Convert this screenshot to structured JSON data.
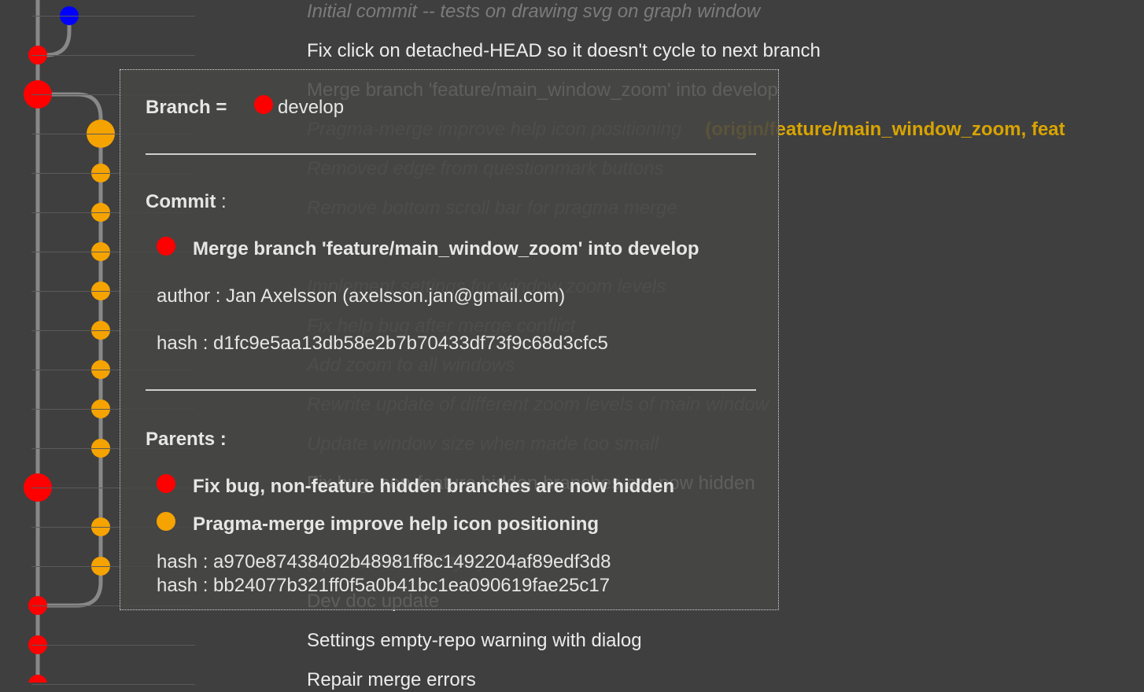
{
  "colors": {
    "background": "#3f3f3f",
    "branch_develop": "#ff0000",
    "branch_feature": "#f5a300",
    "branch_hidden": "#0000ff",
    "edge": "#888888",
    "hidden_text": "#7b7b7b",
    "refs_text": "#d9a400"
  },
  "commits": [
    {
      "message": "Initial commit -- tests on drawing svg on graph window",
      "style": "hidden",
      "node": "branch_hidden",
      "size": "small"
    },
    {
      "message": "Fix click on detached-HEAD so it doesn't cycle to next branch",
      "style": "normal",
      "node": "branch_develop",
      "size": "small"
    },
    {
      "message": "Merge branch 'feature/main_window_zoom' into develop",
      "style": "normal",
      "node": "branch_develop",
      "size": "large"
    },
    {
      "message": "Pragma-merge improve help icon positioning",
      "style": "hidden",
      "refs": "(origin/feature/main_window_zoom, feat",
      "node": "branch_feature",
      "size": "large"
    },
    {
      "message": "Removed edge from questionmark buttons",
      "style": "hidden",
      "node": "branch_feature",
      "size": "small"
    },
    {
      "message": "Remove bottom scroll bar for pragma merge",
      "style": "hidden",
      "node": "branch_feature",
      "size": "small"
    },
    {
      "message": "",
      "style": "hidden",
      "node": "branch_feature",
      "size": "small"
    },
    {
      "message": "Implement settings for window zoom levels",
      "style": "hidden",
      "node": "branch_feature",
      "size": "small"
    },
    {
      "message": "Fix help bug after merge conflict",
      "style": "hidden",
      "node": "branch_feature",
      "size": "small"
    },
    {
      "message": "Add zoom to all windows",
      "style": "hidden",
      "node": "branch_feature",
      "size": "small"
    },
    {
      "message": "Rewrite update of different zoom levels of main window",
      "style": "hidden",
      "node": "branch_feature",
      "size": "small"
    },
    {
      "message": "Update window size when made too small",
      "style": "hidden",
      "node": "branch_feature",
      "size": "small"
    },
    {
      "message": "Fix bug, non-feature hidden branches are now hidden",
      "style": "normal",
      "node": "branch_develop",
      "size": "large"
    },
    {
      "message": "",
      "style": "hidden",
      "node": "branch_feature",
      "size": "small"
    },
    {
      "message": "(updateContentStyle)",
      "style": "hidden",
      "node": "branch_feature",
      "size": "small"
    },
    {
      "message": "Dev doc update",
      "style": "normal",
      "node": "branch_develop",
      "size": "small"
    },
    {
      "message": "Settings empty-repo warning with dialog",
      "style": "normal",
      "node": "branch_develop",
      "size": "small"
    },
    {
      "message": "Repair merge errors",
      "style": "normal",
      "node": "branch_develop",
      "size": "small"
    }
  ],
  "tooltip": {
    "branch_label": "Branch = ",
    "branch_name": "develop",
    "commit_label": "Commit",
    "commit_label_suffix": " :",
    "commit_message": "Merge branch 'feature/main_window_zoom' into develop",
    "author_line": "author : Jan Axelsson (axelsson.jan@gmail.com)",
    "hash_line": "hash : d1fc9e5aa13db58e2b7b70433df73f9c68d3cfc5",
    "parents_label": "Parents :",
    "parents": [
      {
        "message": "Fix bug, non-feature hidden branches are now hidden",
        "color": "#ff0000"
      },
      {
        "message": "Pragma-merge improve help icon positioning",
        "color": "#f5a300"
      }
    ],
    "parent_hashes": [
      "hash : a970e87438402b48981ff8c1492204af89edf3d8",
      "hash : bb24077b321ff0f5a0b41bc1ea090619fae25c17"
    ]
  }
}
